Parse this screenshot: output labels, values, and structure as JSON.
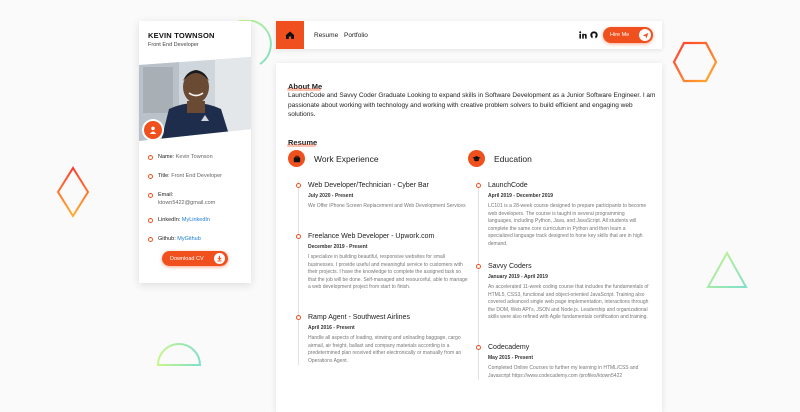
{
  "profile": {
    "name": "KEVIN TOWNSON",
    "title": "Front End Developer",
    "info": {
      "name_label": "Name:",
      "name_value": "Kevin Townson",
      "title_label": "Title:",
      "title_value": "Front End Developer",
      "email_label": "Email:",
      "email_value": "ktown5422@gmail.com",
      "linkedin_label": "LinkedIn:",
      "linkedin_value": "MyLinkedIn",
      "github_label": "Github:",
      "github_value": "MyGithub"
    },
    "download_label": "Download CV"
  },
  "nav": {
    "links": [
      "Resume",
      "Portfolio"
    ],
    "hire_label": "Hire Me"
  },
  "about": {
    "heading": "About Me",
    "text": "LaunchCode and Savvy Coder Graduate Looking to expand skills in Software Development as a Junior Software Engineer. I am passionate about working with technology and working with creative problem solvers to build efficient and engaging web solutions."
  },
  "resume": {
    "heading": "Resume",
    "work": {
      "heading": "Work Experience",
      "items": [
        {
          "title": "Web Developer/Technician - Cyber Bar",
          "date": "July 2020 - Present",
          "desc": "We Offer iPhone Screen Replacement and Web Development Services"
        },
        {
          "title": "Freelance Web Developer - Upwork.com",
          "date": "December 2019 - Present",
          "desc": "I specialize in building beautiful, responsive websites for small businesses. I provide useful and meaningful service to customers with their projects. I have the knowledge to complete the assigned task so that the job will be done. Self-managed and resourceful, able to manage a web development project from start to finish."
        },
        {
          "title": "Ramp Agent - Southwest Airlines",
          "date": "April 2016 - Present",
          "desc": "Handle all aspects of loading, stowing and unloading baggage, cargo airmail, air freight, ballast and company materials according to a predetermined plan received either electronically or manually from an Operations Agent."
        }
      ]
    },
    "education": {
      "heading": "Education",
      "items": [
        {
          "title": "LaunchCode",
          "date": "April 2019 - December 2019",
          "desc": "LC101 is a 28-week course designed to prepare participants to become web developers. The course is taught in several programming languages, including Python, Java, and JavaScript. All students will complete the same core curriculum in Python and then learn a specialized language track designed to hone key skills that are in high demand."
        },
        {
          "title": "Savvy Coders",
          "date": "January 2019 - April 2019",
          "desc": "An accelerated 11-week coding course that includes the fundamentals of HTML5, CSS3, functional and object-oriented JavaScript. Training also covered advanced single web page implementation, interactions through the DOM, Web API's, JSON and Node.js. Leadership and organizational skills were also refined with Agile fundamentals certification and training."
        },
        {
          "title": "Codecademy",
          "date": "May 2015 - Present",
          "desc": "Completed Online Courses to further my learning in HTML/CSS and Javascript https://www.codecademy.com /profiles/ktown5422"
        }
      ]
    }
  },
  "colors": {
    "accent": "#f0501d",
    "link": "#1a7fd6"
  }
}
